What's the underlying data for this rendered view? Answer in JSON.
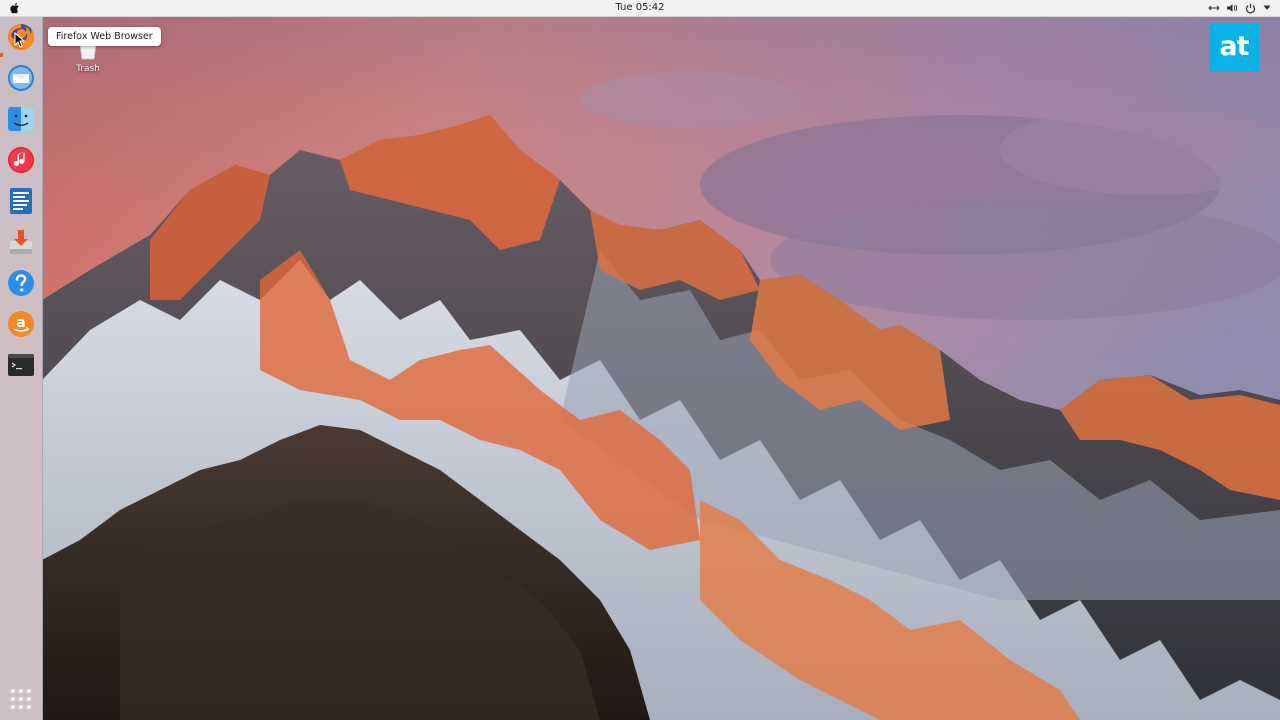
{
  "topbar": {
    "clock": "Tue 05:42",
    "left_icon": "apple-icon",
    "tray_icons": [
      "network-icon",
      "volume-icon",
      "power-icon",
      "chevron-down-icon"
    ]
  },
  "dock": {
    "items": [
      {
        "name": "firefox",
        "icon": "firefox-icon",
        "active": true
      },
      {
        "name": "thunderbird",
        "icon": "mail-icon"
      },
      {
        "name": "files",
        "icon": "finder-icon"
      },
      {
        "name": "rhythmbox",
        "icon": "music-icon"
      },
      {
        "name": "writer",
        "icon": "document-icon"
      },
      {
        "name": "software",
        "icon": "installer-icon"
      },
      {
        "name": "help",
        "icon": "help-icon"
      },
      {
        "name": "amazon",
        "icon": "amazon-icon"
      },
      {
        "name": "terminal",
        "icon": "terminal-icon"
      }
    ],
    "show_apps_icon": "apps-grid-icon"
  },
  "desktop": {
    "trash_label": "Trash"
  },
  "tooltip": {
    "text": "Firefox Web Browser"
  },
  "logo": {
    "text": "at",
    "color": "#0ab1e6"
  },
  "colors": {
    "accent": "#e95420",
    "topbar_bg": "#f2f2f2"
  }
}
